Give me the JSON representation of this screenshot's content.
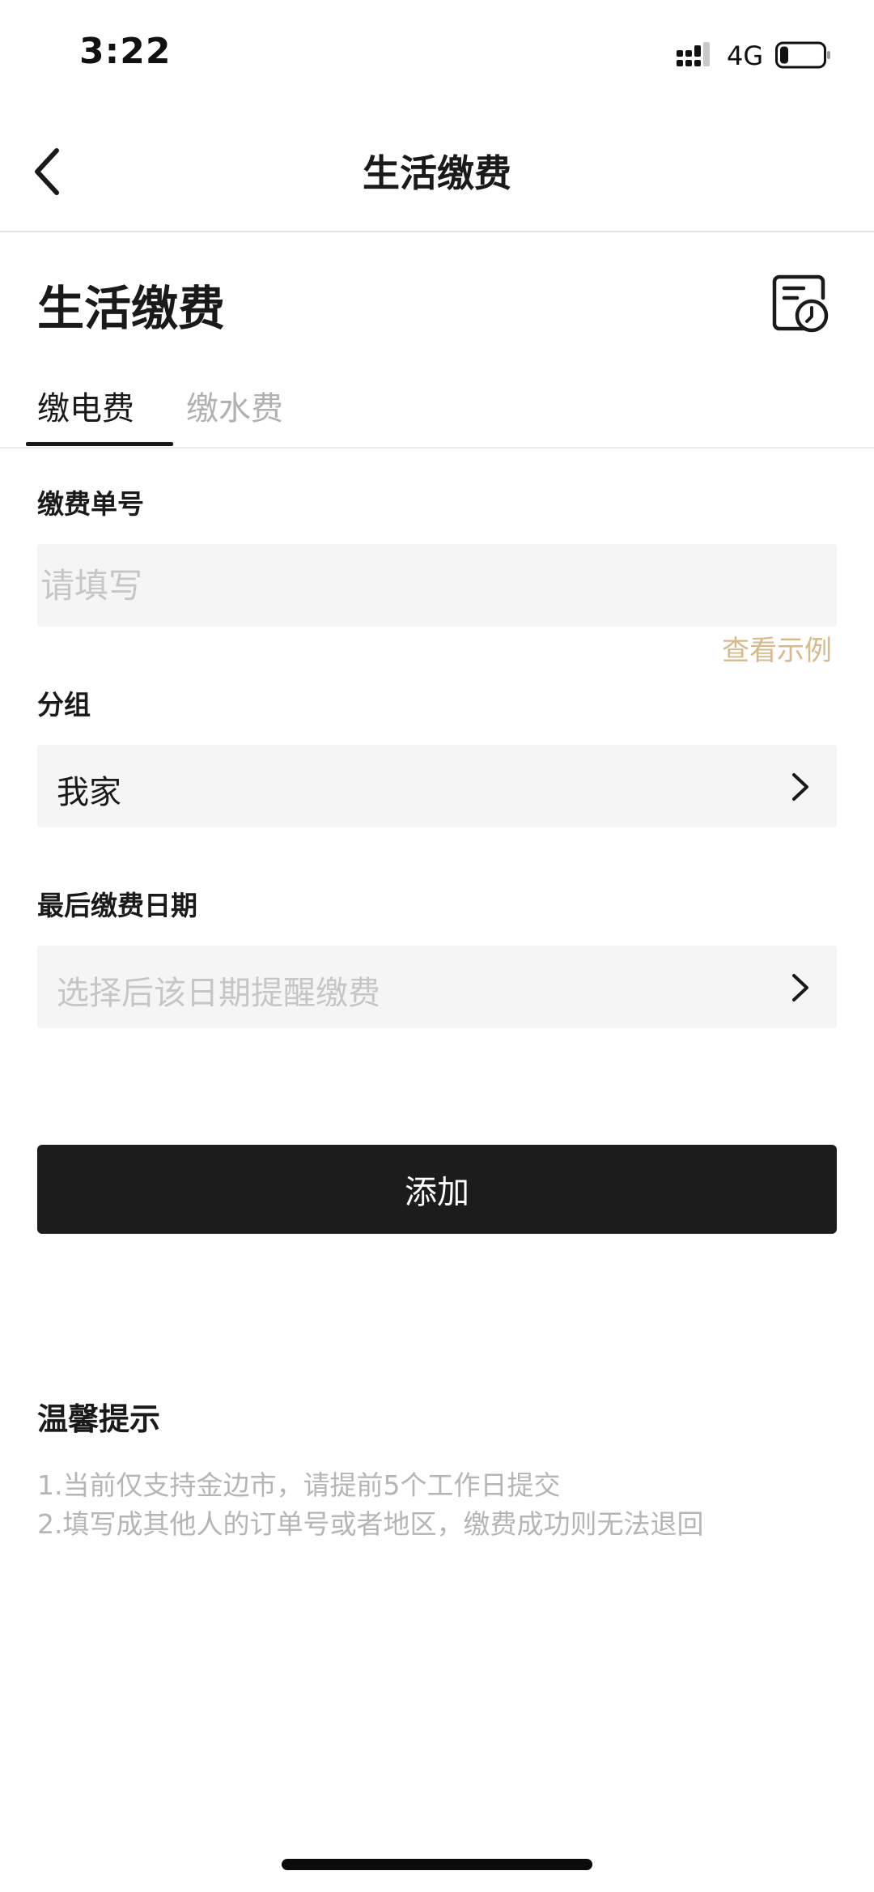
{
  "status_bar": {
    "time": "3:22",
    "network": "4G",
    "battery_level": 0.2
  },
  "nav": {
    "title": "生活缴费"
  },
  "header": {
    "title": "生活缴费"
  },
  "tabs": [
    {
      "label": "缴电费",
      "active": true
    },
    {
      "label": "缴水费",
      "active": false
    }
  ],
  "form": {
    "bill_number": {
      "label": "缴费单号",
      "placeholder": "请填写",
      "value": ""
    },
    "example_link": "查看示例",
    "group": {
      "label": "分组",
      "value": "我家"
    },
    "last_date": {
      "label": "最后缴费日期",
      "placeholder": "选择后该日期提醒缴费"
    }
  },
  "add_button": {
    "label": "添加"
  },
  "tips": {
    "title": "温馨提示",
    "lines": [
      "1.当前仅支持金边市，请提前5个工作日提交",
      "2.填写成其他人的订单号或者地区，缴费成功则无法退回"
    ]
  },
  "colors": {
    "accent_link": "#d8b98a",
    "primary_button": "#1c1c1c",
    "placeholder": "#c6c6c6"
  },
  "icons": {
    "back": "chevron-left-icon",
    "history": "bill-history-icon",
    "select_arrow": "chevron-right-icon"
  }
}
